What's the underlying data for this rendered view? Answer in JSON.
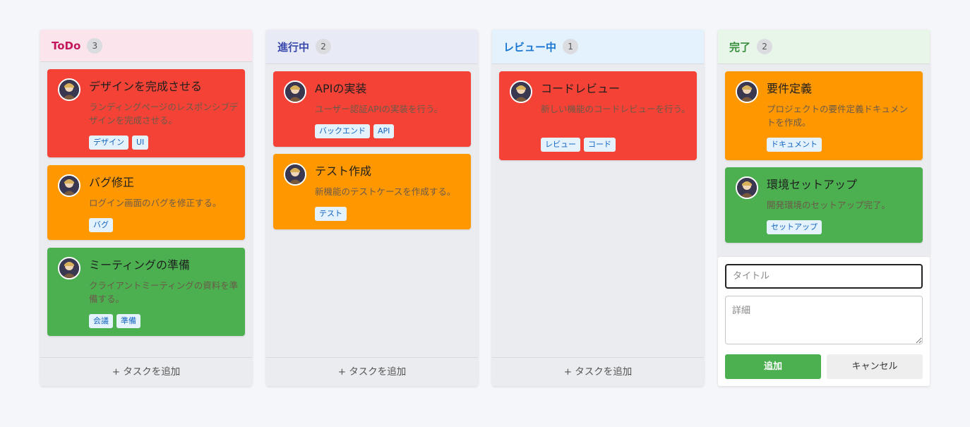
{
  "columns": [
    {
      "title": "ToDo",
      "count": "3",
      "header_bg": "#fce4ec",
      "title_color": "#c2185b",
      "add_label": "+ タスクを追加",
      "cards": [
        {
          "title": "デザインを完成させる",
          "desc": "ランディングページのレスポンシブデザインを完成させる。",
          "color": "#f44336",
          "tags": [
            "デザイン",
            "UI"
          ]
        },
        {
          "title": "バグ修正",
          "desc": "ログイン画面のバグを修正する。",
          "color": "#ff9800",
          "tags": [
            "バグ"
          ]
        },
        {
          "title": "ミーティングの準備",
          "desc": "クライアントミーティングの資料を準備する。",
          "color": "#4caf50",
          "tags": [
            "会議",
            "準備"
          ]
        }
      ]
    },
    {
      "title": "進行中",
      "count": "2",
      "header_bg": "#e8eaf6",
      "title_color": "#3949ab",
      "add_label": "+ タスクを追加",
      "cards": [
        {
          "title": "APIの実装",
          "desc": "ユーザー認証APIの実装を行う。",
          "color": "#f44336",
          "tags": [
            "バックエンド",
            "API"
          ]
        },
        {
          "title": "テスト作成",
          "desc": "新機能のテストケースを作成する。",
          "color": "#ff9800",
          "tags": [
            "テスト"
          ]
        }
      ]
    },
    {
      "title": "レビュー中",
      "count": "1",
      "header_bg": "#e3f2fd",
      "title_color": "#1976d2",
      "add_label": "+ タスクを追加",
      "cards": [
        {
          "title": "コードレビュー",
          "desc": "新しい機能のコードレビューを行う。",
          "color": "#f44336",
          "tags": [
            "レビュー",
            "コード"
          ]
        }
      ]
    },
    {
      "title": "完了",
      "count": "2",
      "header_bg": "#e8f5e9",
      "title_color": "#388e3c",
      "cards": [
        {
          "title": "要件定義",
          "desc": "プロジェクトの要件定義ドキュメントを作成。",
          "color": "#ff9800",
          "tags": [
            "ドキュメント"
          ]
        },
        {
          "title": "環境セットアップ",
          "desc": "開発環境のセットアップ完了。",
          "color": "#4caf50",
          "tags": [
            "セットアップ"
          ]
        }
      ]
    }
  ],
  "form": {
    "title_placeholder": "タイトル",
    "desc_placeholder": "詳細",
    "add_label": "追加",
    "cancel_label": "キャンセル"
  },
  "colors": {
    "primary": "#4caf50",
    "tag_bg": "#e3f2fd",
    "tag_text": "#1565c0"
  },
  "icons": {
    "avatar": "user-avatar-icon"
  }
}
